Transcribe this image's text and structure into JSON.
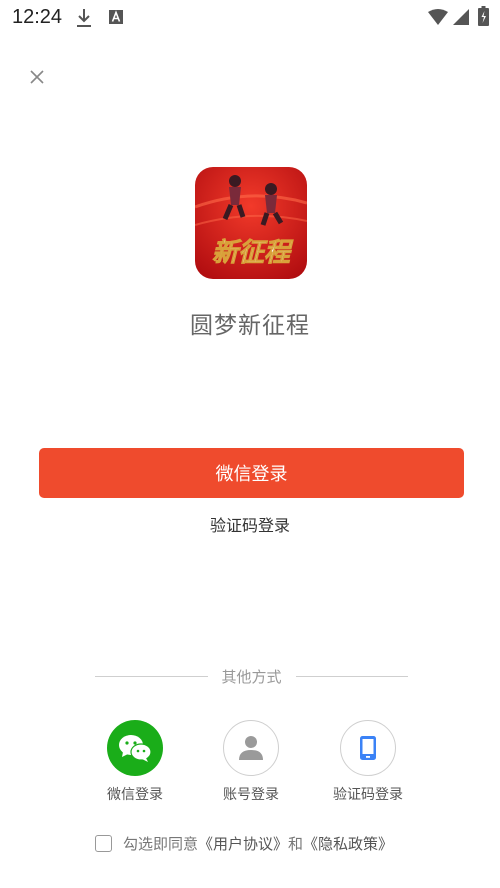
{
  "status_bar": {
    "time": "12:24"
  },
  "app": {
    "name": "圆梦新征程",
    "logo_text": "新征程"
  },
  "buttons": {
    "wechat_login": "微信登录",
    "sms_login": "验证码登录"
  },
  "other_methods": {
    "title": "其他方式",
    "items": [
      {
        "label": "微信登录",
        "icon": "wechat-icon"
      },
      {
        "label": "账号登录",
        "icon": "user-icon"
      },
      {
        "label": "验证码登录",
        "icon": "phone-icon"
      }
    ]
  },
  "agreement": {
    "prefix": "勾选即同意",
    "user_agreement": "《用户协议》",
    "and": "和",
    "privacy_policy": "《隐私政策》"
  },
  "colors": {
    "primary": "#ef4b2d",
    "wechat_green": "#1aad19",
    "phone_blue": "#3b82f6"
  }
}
